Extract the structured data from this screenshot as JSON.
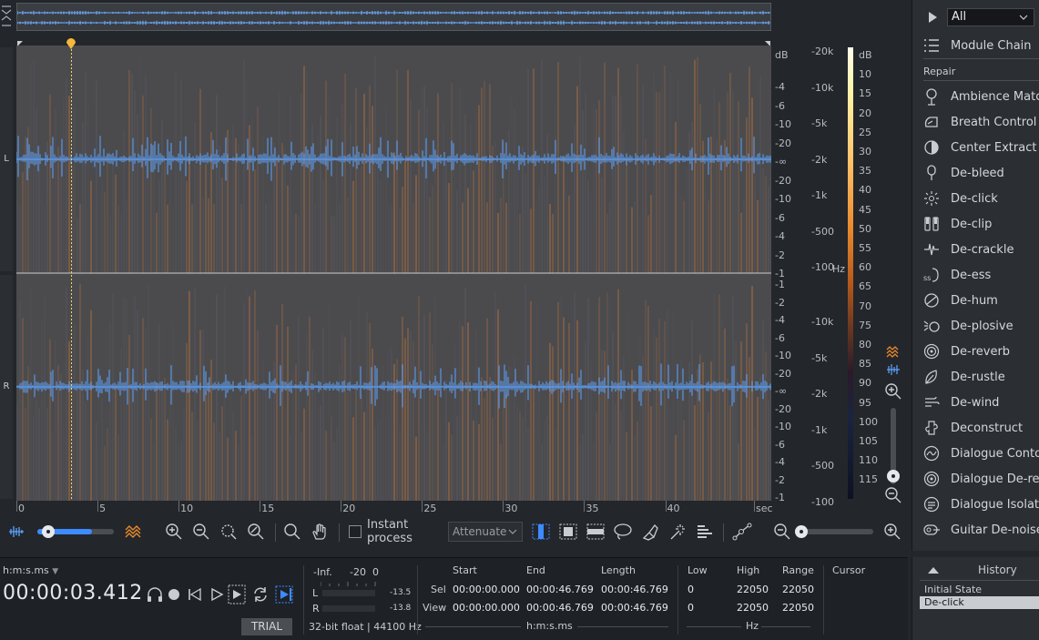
{
  "channels": {
    "left": "L",
    "right": "R"
  },
  "scales": {
    "db_unit": "dB",
    "hz_unit": "Hz",
    "db_top": [
      "-4",
      "-6",
      "-10",
      "-20",
      "-∞",
      "-20",
      "-10",
      "-6",
      "-4",
      "-2",
      "-1"
    ],
    "db_bot": [
      "-1",
      "-2",
      "-4",
      "-6",
      "-10",
      "-20",
      "-∞",
      "-20",
      "-10",
      "-6",
      "-4",
      "-2",
      "-1"
    ],
    "hz_top": [
      "-20k",
      "-10k",
      "-5k",
      "-2k",
      "-1k",
      "-500",
      "-100"
    ],
    "hz_bot": [
      "-10k",
      "-5k",
      "-2k",
      "-1k",
      "-500",
      "-100"
    ],
    "colorbar": [
      "dB",
      "10",
      "15",
      "20",
      "25",
      "30",
      "35",
      "40",
      "45",
      "50",
      "55",
      "60",
      "65",
      "70",
      "75",
      "80",
      "85",
      "90",
      "95",
      "100",
      "105",
      "110",
      "115"
    ]
  },
  "time_axis": [
    "0",
    "5",
    "10",
    "15",
    "20",
    "25",
    "30",
    "35",
    "40",
    "sec"
  ],
  "toolbar": {
    "instant_process": "Instant process",
    "attenuate": "Attenuate"
  },
  "transport": {
    "time_format": "h:m:s.ms",
    "time": "00:00:03.412",
    "trial": "TRIAL",
    "format_info": "32-bit float | 44100 Hz"
  },
  "meter": {
    "inf": "-Inf.",
    "m20": "-20",
    "zero": "0",
    "L": "L",
    "R": "R",
    "l_val": "-13.5",
    "r_val": "-13.8"
  },
  "selection": {
    "headers": [
      "Start",
      "End",
      "Length"
    ],
    "sel_label": "Sel",
    "view_label": "View",
    "sel": [
      "00:00:00.000",
      "00:00:46.769",
      "00:00:46.769"
    ],
    "view": [
      "00:00:00.000",
      "00:00:46.769",
      "00:00:46.769"
    ],
    "unit": "h:m:s.ms"
  },
  "frequency": {
    "headers": [
      "Low",
      "High",
      "Range"
    ],
    "sel": [
      "0",
      "22050",
      "22050"
    ],
    "view": [
      "0",
      "22050",
      "22050"
    ],
    "unit": "Hz"
  },
  "cursor_label": "Cursor",
  "panel": {
    "filter": "All",
    "module_chain": "Module Chain",
    "section": "Repair",
    "modules": [
      {
        "label": "Ambience Match",
        "icon": "ambience-match-icon"
      },
      {
        "label": "Breath Control",
        "icon": "breath-control-icon"
      },
      {
        "label": "Center Extract",
        "icon": "center-extract-icon"
      },
      {
        "label": "De-bleed",
        "icon": "de-bleed-icon"
      },
      {
        "label": "De-click",
        "icon": "de-click-icon"
      },
      {
        "label": "De-clip",
        "icon": "de-clip-icon"
      },
      {
        "label": "De-crackle",
        "icon": "de-crackle-icon"
      },
      {
        "label": "De-ess",
        "icon": "de-ess-icon"
      },
      {
        "label": "De-hum",
        "icon": "de-hum-icon"
      },
      {
        "label": "De-plosive",
        "icon": "de-plosive-icon"
      },
      {
        "label": "De-reverb",
        "icon": "de-reverb-icon"
      },
      {
        "label": "De-rustle",
        "icon": "de-rustle-icon"
      },
      {
        "label": "De-wind",
        "icon": "de-wind-icon"
      },
      {
        "label": "Deconstruct",
        "icon": "deconstruct-icon"
      },
      {
        "label": "Dialogue Contour",
        "icon": "dialogue-contour-icon"
      },
      {
        "label": "Dialogue De-reverb",
        "icon": "dialogue-de-reverb-icon"
      },
      {
        "label": "Dialogue Isolate",
        "icon": "dialogue-isolate-icon"
      },
      {
        "label": "Guitar De-noise",
        "icon": "guitar-de-noise-icon"
      }
    ]
  },
  "history": {
    "title": "History",
    "items": [
      "Initial State",
      "De-click"
    ],
    "selected_index": 1
  },
  "playhead_seconds": 3.412,
  "duration_seconds": 46.769,
  "colors": {
    "waveform": "#5ea4ff",
    "accent": "#3d8bff",
    "playhead": "#f5b83d",
    "spectral_orange": "#c8773a"
  }
}
